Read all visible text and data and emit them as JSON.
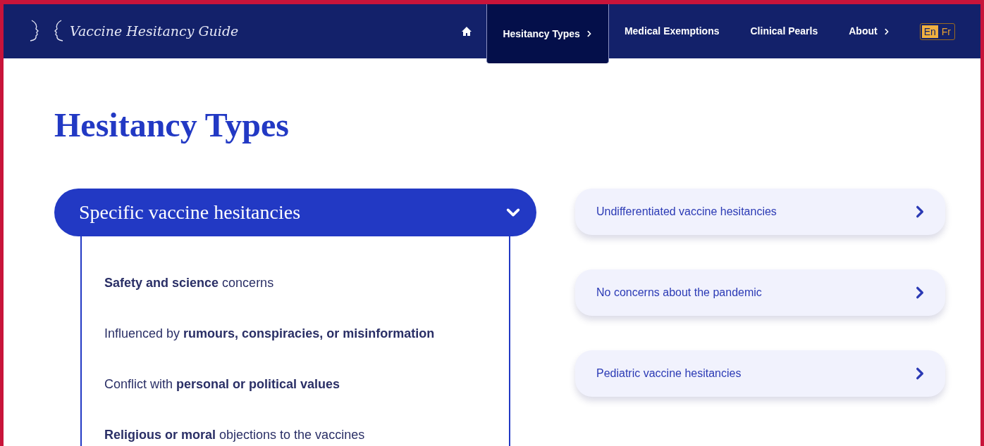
{
  "site_title": "Vaccine Hesitancy Guide",
  "nav": [
    {
      "kind": "home",
      "selected": false,
      "submenu": false
    },
    {
      "kind": "link",
      "label": "Hesitancy Types",
      "selected": true,
      "submenu": true
    },
    {
      "kind": "link",
      "label": "Medical Exemptions",
      "selected": false,
      "submenu": false
    },
    {
      "kind": "link",
      "label": "Clinical Pearls",
      "selected": false,
      "submenu": false
    },
    {
      "kind": "link",
      "label": "About",
      "selected": false,
      "submenu": true
    }
  ],
  "languages": [
    {
      "label": "En",
      "selected": true
    },
    {
      "label": "Fr",
      "selected": false
    }
  ],
  "heading": "Hesitancy Types",
  "sections": [
    {
      "title": "Specific vaccine hesitancies",
      "expanded": true,
      "items": [
        "**Safety and science** concerns",
        "Influenced by **rumours, conspiracies, or misinformation**",
        "Conflict with **personal or political values**",
        "**Religious or moral** objections to the vaccines"
      ]
    },
    {
      "title": "Undifferentiated vaccine hesitancies",
      "expanded": false
    },
    {
      "title": "No concerns about the pandemic",
      "expanded": false
    },
    {
      "title": "Pediatric vaccine hesitancies",
      "expanded": false
    }
  ]
}
